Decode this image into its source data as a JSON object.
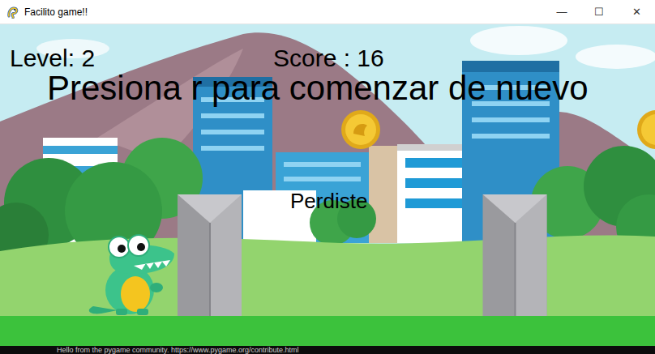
{
  "window": {
    "title": "Facilito game!!",
    "controls": [
      "—",
      "☐",
      "✕"
    ]
  },
  "hud": {
    "level": "Level: 2",
    "score": "Score : 16"
  },
  "message": {
    "restart": "Presiona r para comenzar de nuevo",
    "status": "Perdiste"
  },
  "console": {
    "text": "Hello from the pygame community. https://www.pygame.org/contribute.html"
  }
}
